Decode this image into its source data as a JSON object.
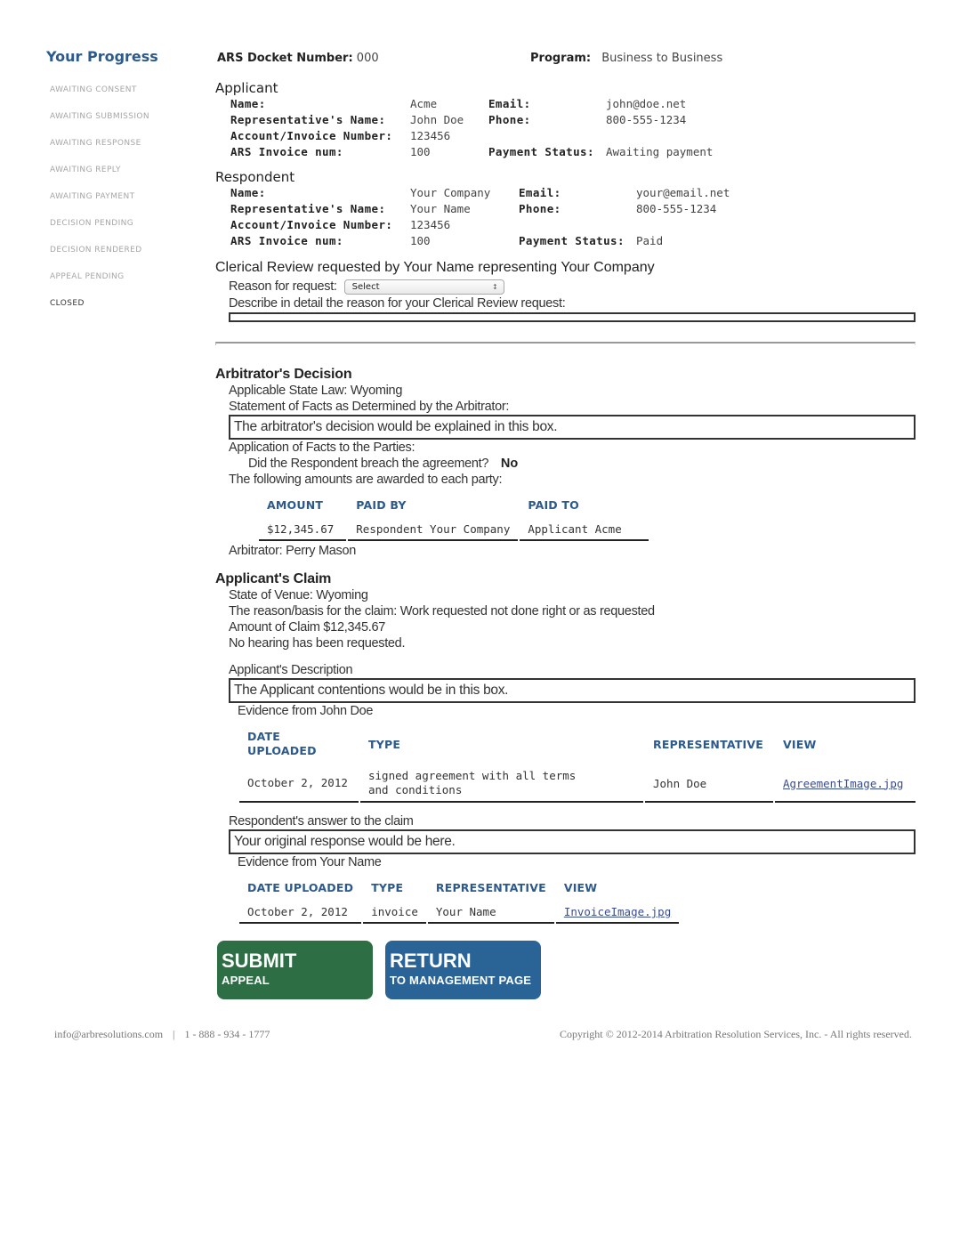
{
  "sidebar": {
    "title": "Your Progress",
    "steps": [
      {
        "label": "AWAITING CONSENT",
        "current": false
      },
      {
        "label": "AWAITING SUBMISSION",
        "current": false
      },
      {
        "label": "AWAITING RESPONSE",
        "current": false
      },
      {
        "label": "AWAITING REPLY",
        "current": false
      },
      {
        "label": "AWAITING PAYMENT",
        "current": false
      },
      {
        "label": "DECISION PENDING",
        "current": false
      },
      {
        "label": "DECISION RENDERED",
        "current": false
      },
      {
        "label": "APPEAL PENDING",
        "current": false
      },
      {
        "label": "CLOSED",
        "current": true
      }
    ]
  },
  "header": {
    "docket_label": "ARS Docket Number:",
    "docket_value": "000",
    "program_label": "Program:",
    "program_value": "Business to Business"
  },
  "applicant": {
    "title": "Applicant",
    "name_label": "Name:",
    "name": "Acme",
    "email_label": "Email:",
    "email": "john@doe.net",
    "rep_label": "Representative's Name:",
    "rep": "John Doe",
    "phone_label": "Phone:",
    "phone": "800-555-1234",
    "account_label": "Account/Invoice Number:",
    "account": "123456",
    "invoice_label": "ARS Invoice num:",
    "invoice": "100",
    "payment_label": "Payment Status:",
    "payment": "Awaiting payment"
  },
  "respondent": {
    "title": "Respondent",
    "name_label": "Name:",
    "name": "Your Company",
    "email_label": "Email:",
    "email": "your@email.net",
    "rep_label": "Representative's Name:",
    "rep": "Your Name",
    "phone_label": "Phone:",
    "phone": "800-555-1234",
    "account_label": "Account/Invoice Number:",
    "account": "123456",
    "invoice_label": "ARS Invoice num:",
    "invoice": "100",
    "payment_label": "Payment Status:",
    "payment": "Paid"
  },
  "clerical": {
    "title": "Clerical Review requested by Your Name representing Your Company",
    "reason_label": "Reason for request:",
    "reason_select": "Select",
    "describe_label": "Describe in detail the reason for your Clerical Review request:",
    "describe_value": ""
  },
  "decision": {
    "title": "Arbitrator's Decision",
    "state_law": "Applicable State Law: Wyoming",
    "facts_label": "Statement of Facts as Determined by the Arbitrator:",
    "facts_text": "The arbitrator's decision would be explained in this box.",
    "application_label": "Application of Facts to the Parties:",
    "breach_question": "Did the Respondent breach the agreement?",
    "breach_answer": "No",
    "awards_label": "The following amounts are awarded to each party:",
    "award_headers": {
      "amount": "AMOUNT",
      "paid_by": "PAID BY",
      "paid_to": "PAID TO"
    },
    "awards": [
      {
        "amount": "$12,345.67",
        "paid_by": "Respondent Your Company",
        "paid_to": "Applicant Acme"
      }
    ],
    "arbitrator": "Arbitrator: Perry Mason"
  },
  "claim": {
    "title": "Applicant's Claim",
    "venue_label": "State of Venue:",
    "venue": "Wyoming",
    "basis_label": "The reason/basis for the claim:",
    "basis": "Work requested not done right or as requested",
    "amount_label": "Amount of Claim",
    "amount": "$12,345.67",
    "hearing": "No hearing has been requested.",
    "applicant_desc_label": "Applicant's Description",
    "applicant_desc": "The Applicant contentions would be in this box.",
    "applicant_evidence_label": "Evidence from John Doe",
    "applicant_evidence_headers": {
      "date": "DATE UPLOADED",
      "type": "TYPE",
      "rep": "REPRESENTATIVE",
      "view": "VIEW"
    },
    "applicant_evidence": [
      {
        "date": "October 2, 2012",
        "type": "signed agreement with all terms and conditions",
        "rep": "John Doe",
        "view": "AgreementImage.jpg"
      }
    ],
    "respondent_answer_label": "Respondent's answer to the claim",
    "respondent_answer": "Your original response would be here.",
    "respondent_evidence_label": "Evidence from Your Name",
    "respondent_evidence_headers": {
      "date": "DATE UPLOADED",
      "type": "TYPE",
      "rep": "REPRESENTATIVE",
      "view": "VIEW"
    },
    "respondent_evidence": [
      {
        "date": "October 2, 2012",
        "type": "invoice",
        "rep": "Your Name",
        "view": "InvoiceImage.jpg"
      }
    ]
  },
  "buttons": {
    "submit_big": "SUBMIT",
    "submit_small": "APPEAL",
    "submit_color": "#2e6e44",
    "return_big": "RETURN",
    "return_small": "TO MANAGEMENT PAGE",
    "return_color": "#2a6497"
  },
  "footer": {
    "email": "info@arbresolutions.com",
    "separator": "|",
    "phone": "1 - 888 - 934 - 1777",
    "copyright": "Copyright © 2012-2014 Arbitration Resolution Services, Inc. - All rights reserved."
  },
  "colors": {
    "accent": "#2c5a8c",
    "link": "#3a4d8f"
  }
}
